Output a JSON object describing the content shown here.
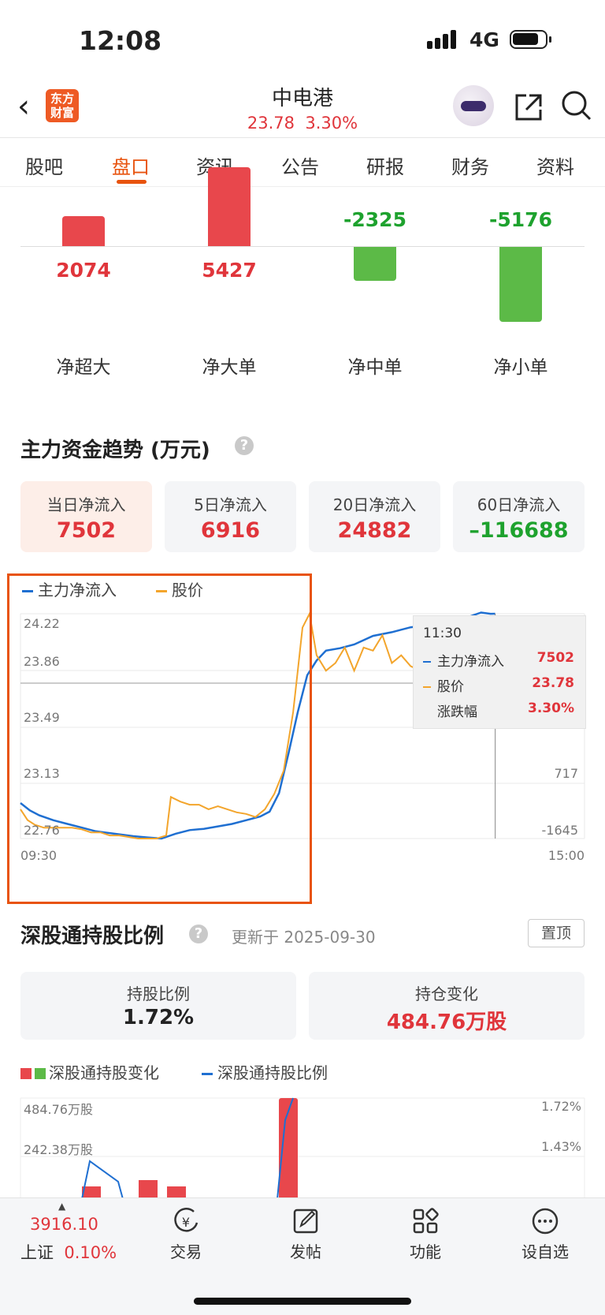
{
  "status": {
    "time": "12:08",
    "network": "4G"
  },
  "header": {
    "logo_text": "东方财富",
    "title": "中电港",
    "price": "23.78",
    "change": "3.30%"
  },
  "tabs": [
    "股吧",
    "盘口",
    "资讯",
    "公告",
    "研报",
    "财务",
    "资料"
  ],
  "net_flow": [
    {
      "label": "净超大",
      "value": "2074",
      "num": 2074
    },
    {
      "label": "净大单",
      "value": "5427",
      "num": 5427
    },
    {
      "label": "净中单",
      "value": "-2325",
      "num": -2325
    },
    {
      "label": "净小单",
      "value": "-5176",
      "num": -5176
    }
  ],
  "trend": {
    "title": "主力资金趋势 (万元)",
    "help": "?",
    "cards": [
      {
        "label": "当日净流入",
        "value": "7502"
      },
      {
        "label": "5日净流入",
        "value": "6916"
      },
      {
        "label": "20日净流入",
        "value": "24882"
      },
      {
        "label": "60日净流入",
        "value": "–116688"
      }
    ]
  },
  "chart_data": {
    "type": "line",
    "legend": [
      "主力净流入",
      "股价"
    ],
    "y_left_ticks": [
      "24.22",
      "23.86",
      "23.49",
      "23.13",
      "22.76"
    ],
    "y_right_ticks": [
      "7502",
      "717",
      "-1645"
    ],
    "x_ticks": [
      "09:30",
      "15:00"
    ],
    "colors": {
      "flow": "#1f6fd1",
      "price": "#f3a52c"
    },
    "x_span": [
      0,
      240
    ],
    "price_range": [
      22.76,
      24.22
    ],
    "flow_range": [
      -1645,
      7502
    ],
    "price": [
      [
        0,
        22.95
      ],
      [
        3,
        22.88
      ],
      [
        6,
        22.85
      ],
      [
        10,
        22.83
      ],
      [
        14,
        22.83
      ],
      [
        18,
        22.83
      ],
      [
        22,
        22.83
      ],
      [
        26,
        22.82
      ],
      [
        30,
        22.8
      ],
      [
        34,
        22.8
      ],
      [
        38,
        22.78
      ],
      [
        42,
        22.78
      ],
      [
        46,
        22.77
      ],
      [
        50,
        22.76
      ],
      [
        54,
        22.76
      ],
      [
        58,
        22.76
      ],
      [
        62,
        22.78
      ],
      [
        64,
        23.03
      ],
      [
        68,
        23.0
      ],
      [
        72,
        22.98
      ],
      [
        76,
        22.98
      ],
      [
        80,
        22.95
      ],
      [
        84,
        22.97
      ],
      [
        88,
        22.95
      ],
      [
        92,
        22.93
      ],
      [
        96,
        22.92
      ],
      [
        100,
        22.9
      ],
      [
        104,
        22.95
      ],
      [
        108,
        23.05
      ],
      [
        112,
        23.2
      ],
      [
        116,
        23.58
      ],
      [
        118,
        23.85
      ],
      [
        120,
        24.13
      ],
      [
        123,
        24.22
      ],
      [
        126,
        23.95
      ],
      [
        130,
        23.85
      ],
      [
        134,
        23.9
      ],
      [
        138,
        24.0
      ],
      [
        142,
        23.85
      ],
      [
        146,
        24.0
      ],
      [
        150,
        23.98
      ],
      [
        154,
        24.08
      ],
      [
        158,
        23.9
      ],
      [
        162,
        23.95
      ],
      [
        166,
        23.88
      ],
      [
        170,
        23.85
      ],
      [
        174,
        23.82
      ],
      [
        178,
        23.9
      ],
      [
        182,
        23.88
      ],
      [
        186,
        23.82
      ],
      [
        190,
        23.85
      ],
      [
        194,
        23.88
      ],
      [
        198,
        23.78
      ],
      [
        200,
        23.72
      ],
      [
        202,
        23.78
      ]
    ],
    "flow": [
      [
        0,
        -200
      ],
      [
        4,
        -500
      ],
      [
        8,
        -700
      ],
      [
        14,
        -900
      ],
      [
        20,
        -1050
      ],
      [
        26,
        -1200
      ],
      [
        32,
        -1350
      ],
      [
        40,
        -1450
      ],
      [
        48,
        -1550
      ],
      [
        54,
        -1600
      ],
      [
        60,
        -1645
      ],
      [
        66,
        -1450
      ],
      [
        72,
        -1300
      ],
      [
        78,
        -1250
      ],
      [
        84,
        -1150
      ],
      [
        90,
        -1050
      ],
      [
        96,
        -900
      ],
      [
        102,
        -750
      ],
      [
        106,
        -550
      ],
      [
        110,
        200
      ],
      [
        114,
        1800
      ],
      [
        118,
        3500
      ],
      [
        122,
        5000
      ],
      [
        126,
        5600
      ],
      [
        130,
        6000
      ],
      [
        136,
        6100
      ],
      [
        142,
        6250
      ],
      [
        150,
        6600
      ],
      [
        158,
        6750
      ],
      [
        166,
        6950
      ],
      [
        174,
        7050
      ],
      [
        182,
        7200
      ],
      [
        190,
        7350
      ],
      [
        196,
        7550
      ],
      [
        200,
        7500
      ],
      [
        202,
        7502
      ]
    ],
    "tooltip": {
      "time": "11:30",
      "flow_label": "主力净流入",
      "flow": "7502",
      "price_label": "股价",
      "price": "23.78",
      "pct_label": "涨跌幅",
      "pct": "3.30%"
    }
  },
  "hk": {
    "title": "深股通持股比例",
    "help": "?",
    "updated": "更新于 2025-09-30",
    "pin": "置顶",
    "ratio_label": "持股比例",
    "ratio": "1.72%",
    "pos_label": "持仓变化",
    "pos": "484.76万股",
    "legend_a": "深股通持股变化",
    "legend_b": "深股通持股比例",
    "y_left": [
      "484.76万股",
      "242.38万股"
    ],
    "y_right": [
      "1.72%",
      "1.43%"
    ]
  },
  "bottom_nav": {
    "index_value": "3916.10",
    "index_name": "上证",
    "index_change": "0.10%",
    "items": [
      "交易",
      "发帖",
      "功能",
      "设自选"
    ]
  }
}
